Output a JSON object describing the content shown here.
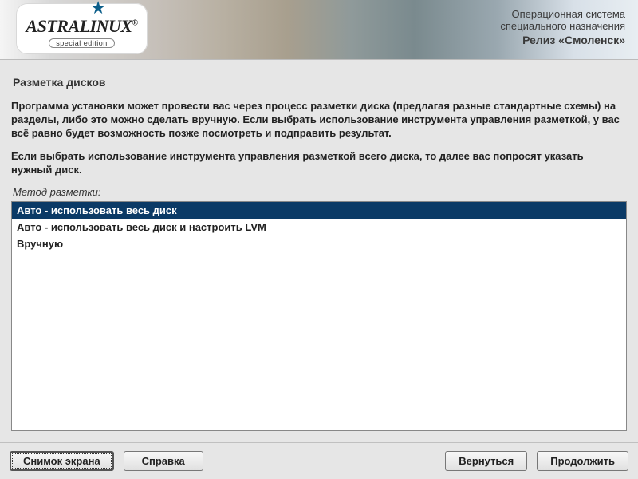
{
  "header": {
    "logo_text": "ASTRALINUX",
    "logo_sub": "special edition",
    "line1": "Операционная система",
    "line2": "специального назначения",
    "line3": "Релиз «Смоленск»"
  },
  "page": {
    "title": "Разметка дисков",
    "desc1": "Программа установки может провести вас через процесс разметки диска (предлагая разные стандартные схемы) на разделы, либо это можно сделать вручную. Если выбрать использование инструмента управления разметкой, у вас всё равно будет возможность позже посмотреть и подправить результат.",
    "desc2": "Если выбрать использование инструмента управления разметкой всего диска, то далее вас попросят указать нужный диск.",
    "method_label": "Метод разметки:",
    "options": [
      {
        "label": "Авто - использовать весь диск",
        "selected": true
      },
      {
        "label": "Авто - использовать весь диск и настроить LVM",
        "selected": false
      },
      {
        "label": "Вручную",
        "selected": false
      }
    ]
  },
  "footer": {
    "screenshot": "Снимок экрана",
    "help": "Справка",
    "back": "Вернуться",
    "continue": "Продолжить"
  }
}
